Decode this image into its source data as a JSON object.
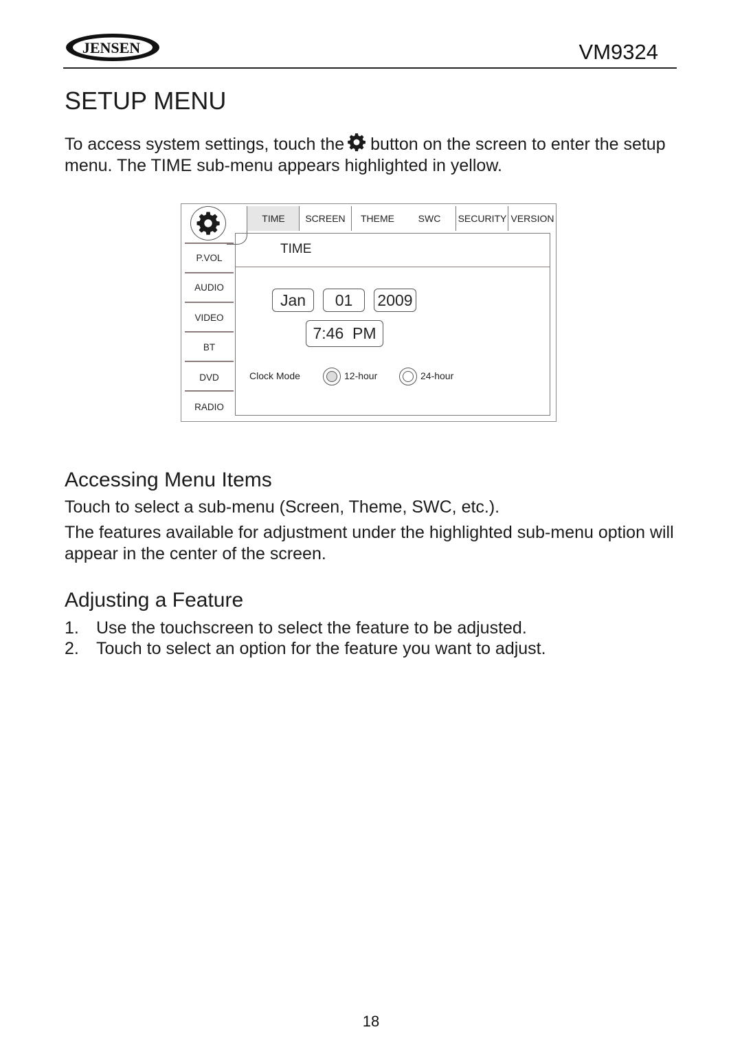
{
  "header": {
    "brand": "JENSEN",
    "model": "VM9324"
  },
  "page_title": "SETUP MENU",
  "intro": {
    "before_icon": "To access system settings, touch the",
    "icon": "gear-icon",
    "after_icon": "button on the screen to enter the setup menu. The  TIME  sub-menu  appears highlighted in yellow."
  },
  "screen": {
    "settings_icon": "gear-icon",
    "tabs": [
      {
        "label": "TIME",
        "active": true
      },
      {
        "label": "SCREEN",
        "active": false
      },
      {
        "label": "THEME",
        "active": false
      },
      {
        "label": "SWC",
        "active": false
      },
      {
        "label": "SECURITY",
        "active": false
      },
      {
        "label": "VERSION",
        "active": false
      }
    ],
    "sidebar": [
      "P.VOL",
      "AUDIO",
      "VIDEO",
      "BT",
      "DVD",
      "RADIO"
    ],
    "panel_title": "TIME",
    "date": {
      "month": "Jan",
      "day": "01",
      "year": "2009"
    },
    "time": "7:46  PM",
    "clock_mode": {
      "label": "Clock Mode",
      "options": [
        {
          "label": "12-hour",
          "selected": true
        },
        {
          "label": "24-hour",
          "selected": false
        }
      ]
    }
  },
  "sections": {
    "accessing": {
      "heading": "Accessing Menu Items",
      "paragraphs": [
        "Touch to select a sub-menu (Screen, Theme, SWC, etc.).",
        "The features available for adjustment under the highlighted sub-menu option will appear in the center of the screen."
      ]
    },
    "adjusting": {
      "heading": "Adjusting a Feature",
      "steps": [
        {
          "num": "1.",
          "text": "Use the touchscreen to select the feature to be adjusted."
        },
        {
          "num": "2.",
          "text": "Touch to select an option for the feature you want to adjust."
        }
      ]
    }
  },
  "page_number": "18"
}
